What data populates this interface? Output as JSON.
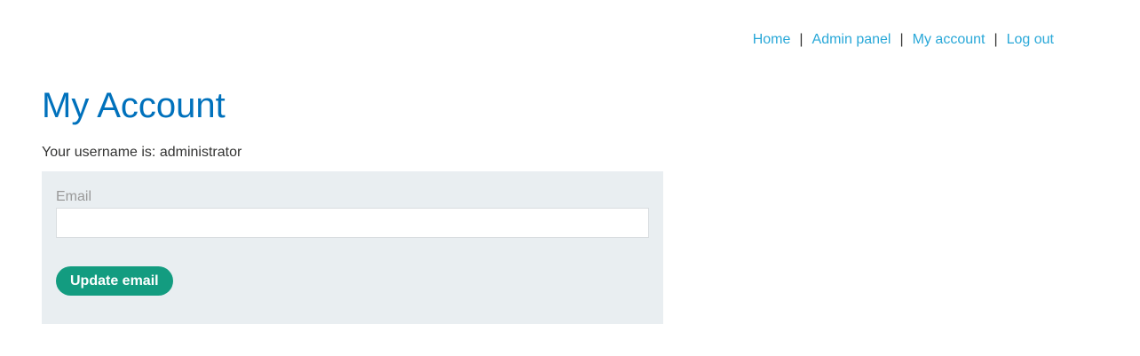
{
  "nav": {
    "items": [
      {
        "label": "Home"
      },
      {
        "label": "Admin panel"
      },
      {
        "label": "My account"
      },
      {
        "label": "Log out"
      }
    ],
    "separator": "|"
  },
  "page": {
    "title": "My Account",
    "username_line": "Your username is: administrator"
  },
  "form": {
    "email_label": "Email",
    "email_value": "",
    "submit_label": "Update email"
  },
  "colors": {
    "link": "#29a8d8",
    "title": "#0071bc",
    "button": "#139c80",
    "panel": "#e9eef1"
  }
}
